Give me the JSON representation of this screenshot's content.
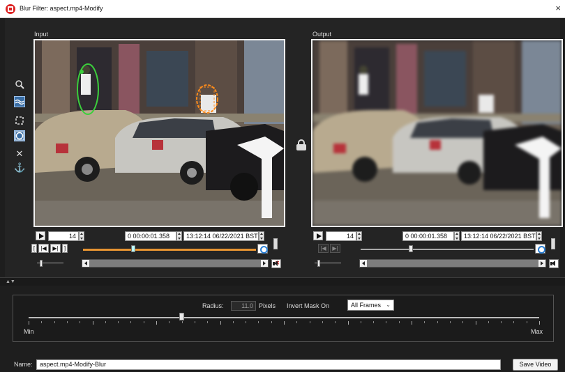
{
  "window": {
    "title": "Blur Filter: aspect.mp4-Modify",
    "close_glyph": "×",
    "icon": "app-logo-icon"
  },
  "input_panel": {
    "label": "Input",
    "frame_number": "14",
    "timecode": "0 00:00:01.358",
    "timestamp": "13:12:14 06/22/2021 BST",
    "playback_position": 0.29
  },
  "output_panel": {
    "label": "Output",
    "frame_number": "14",
    "timecode": "0 00:00:01.358",
    "timestamp": "13:12:14 06/22/2021 BST",
    "playback_position": 0.29
  },
  "toolbar": {
    "tools": [
      "zoom-icon",
      "blur-tool-icon",
      "rectangle-select-icon",
      "ellipse-select-icon",
      "delete-icon",
      "anchor-icon"
    ],
    "active_tools": [
      "blur-tool-icon",
      "ellipse-select-icon"
    ],
    "delete_glyph": "✕",
    "anchor_glyph": "⚓"
  },
  "masks": {
    "green_color": "#3ccf3c",
    "orange_color": "#ff8c1a"
  },
  "settings": {
    "radius_label": "Radius:",
    "radius_value": "11.0",
    "radius_unit": "Pixels",
    "invert_mask_label": "Invert Mask On",
    "invert_mask_value": "All Frames",
    "slider_min_label": "Min",
    "slider_max_label": "Max",
    "radius_fraction": 0.3
  },
  "footer": {
    "name_label": "Name:",
    "name_value": "aspect.mp4-Modify-Blur",
    "save_label": "Save Video"
  },
  "colors": {
    "accent_blue": "#3a6ea5",
    "timeline_orange": "#e89532",
    "background": "#242424"
  }
}
